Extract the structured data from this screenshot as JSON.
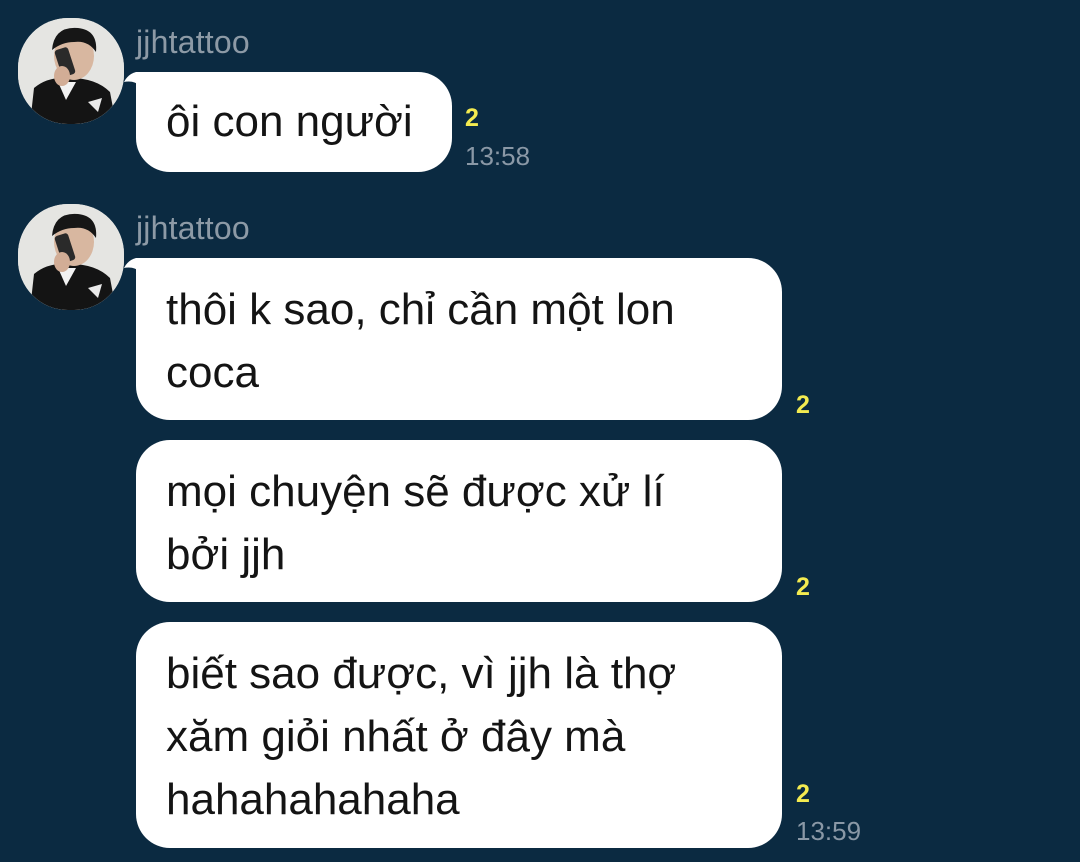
{
  "theme": {
    "background": "#0b2a41",
    "bubble": "#ffffff",
    "read_count_color": "#f4eb50",
    "meta_color": "#8a98a6"
  },
  "groups": [
    {
      "sender": "jjhtattoo",
      "avatar_icon": "profile-photo",
      "messages": [
        {
          "text": "ôi con người",
          "read_count": "2",
          "time": "13:58"
        }
      ]
    },
    {
      "sender": "jjhtattoo",
      "avatar_icon": "profile-photo",
      "messages": [
        {
          "text": "thôi k sao, chỉ cần một lon coca",
          "read_count": "2",
          "time": ""
        },
        {
          "text": "mọi chuyện sẽ được xử lí bởi jjh",
          "read_count": "2",
          "time": ""
        },
        {
          "text": "biết sao được, vì jjh là thợ xăm giỏi nhất ở đây mà hahahahahaha",
          "read_count": "2",
          "time": "13:59"
        }
      ]
    }
  ]
}
